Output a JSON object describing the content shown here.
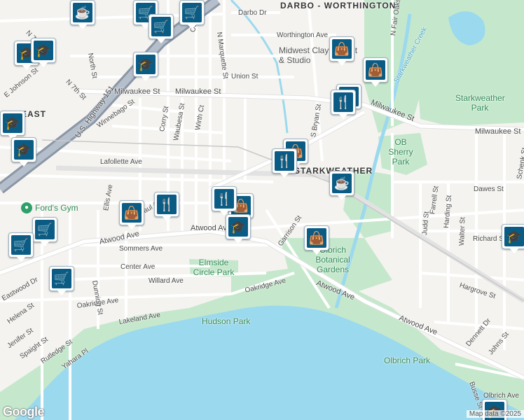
{
  "map": {
    "colors": {
      "land": "#f4f3ef",
      "park": "#c5e8cc",
      "water": "#9bd9ee",
      "road": "#ffffff",
      "highway": "#8a96a6",
      "marker": "#0b5c85"
    },
    "district_labels": [
      {
        "text": "DARBO - WORTHINGTON"
      },
      {
        "text": "EAST"
      },
      {
        "text": "STARKWEATHER"
      }
    ],
    "park_labels": [
      {
        "text": "Starkweather Park"
      },
      {
        "text": "OB Sherry Park"
      },
      {
        "text": "Olbrich Botanical Gardens"
      },
      {
        "text": "Elmside Circle Park"
      },
      {
        "text": "Hudson Park"
      },
      {
        "text": "Olbrich Park"
      }
    ],
    "water_labels": [
      {
        "text": "Starkweather Creek"
      }
    ],
    "poi_labels": [
      {
        "text": "Midwest Clay Project & Studio"
      },
      {
        "text": "Ford's Gym"
      }
    ],
    "street_labels": [
      "Darbo Dr",
      "Worthington Ave",
      "Union St",
      "Milwaukee St",
      "Milwaukee St",
      "Milwaukee St",
      "Milwaukee St",
      "Lafollette Ave",
      "Dawes St",
      "Richard St",
      "Hargrove St",
      "Atwood Ave",
      "Atwood Ave",
      "Atwood Ave",
      "Atwood Ave",
      "Sommers Ave",
      "Center Ave",
      "Willard Ave",
      "Oakridge Ave",
      "Oakridge Ave",
      "Lakeland Ave",
      "Dennett Dr",
      "Johns St",
      "Busse St",
      "Olbrich Ave",
      "N Marquette St",
      "Oak St",
      "North St",
      "N 7th St",
      "N 7th St",
      "E Johnson St",
      "U.S. Highway 151",
      "Winnebago St",
      "Corry St",
      "Waubesa St",
      "Wirth Ct",
      "S Bryan St",
      "N Fair Oaks Ave",
      "Garrison St",
      "Judd St",
      "Farrell St",
      "Harding St",
      "Walter St",
      "Schenk St",
      "Dunning St",
      "Eastwood Dr",
      "Helena St",
      "Jenifer St",
      "Spaight St",
      "Rutledge St",
      "Yahara Pl",
      "Ellis Ave",
      "Paul Ave"
    ],
    "markers": [
      {
        "kind": "cafe"
      },
      {
        "kind": "grocery"
      },
      {
        "kind": "grocery"
      },
      {
        "kind": "grocery"
      },
      {
        "kind": "school"
      },
      {
        "kind": "school"
      },
      {
        "kind": "school"
      },
      {
        "kind": "school"
      },
      {
        "kind": "school"
      },
      {
        "kind": "shopping"
      },
      {
        "kind": "shopping"
      },
      {
        "kind": "restaurant"
      },
      {
        "kind": "restaurant"
      },
      {
        "kind": "shopping"
      },
      {
        "kind": "cafe"
      },
      {
        "kind": "restaurant"
      },
      {
        "kind": "shopping"
      },
      {
        "kind": "school"
      },
      {
        "kind": "shopping"
      },
      {
        "kind": "restaurant"
      },
      {
        "kind": "restaurant"
      },
      {
        "kind": "shopping"
      },
      {
        "kind": "grocery"
      },
      {
        "kind": "grocery"
      },
      {
        "kind": "grocery"
      },
      {
        "kind": "school"
      },
      {
        "kind": "school"
      }
    ]
  },
  "branding": {
    "logo": "Google",
    "attribution": "Map data ©2025"
  }
}
